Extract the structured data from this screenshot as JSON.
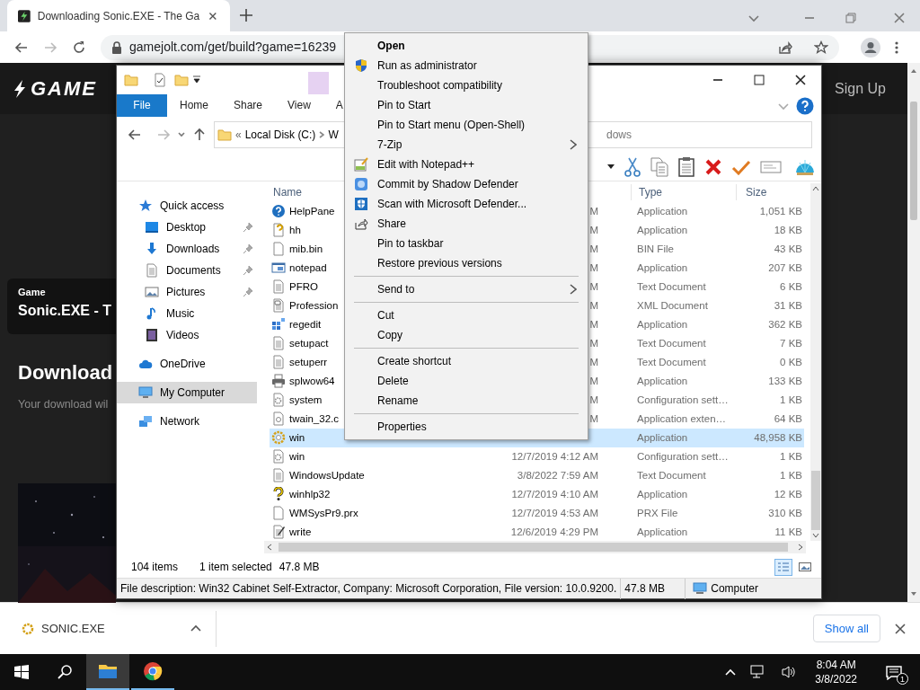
{
  "browser": {
    "tab_title": "Downloading Sonic.EXE - The Ga",
    "url": "gamejolt.com/get/build?game=16239"
  },
  "site": {
    "logo": "GAME",
    "sign_up": "Sign Up",
    "card_label": "Game",
    "card_title": "Sonic.EXE - T",
    "heading": "Download",
    "subtext": "Your download wil"
  },
  "explorer": {
    "ribbon_tabs": [
      {
        "kind": "file",
        "label": "File"
      },
      {
        "kind": "tab",
        "label": "Home"
      },
      {
        "kind": "tab",
        "label": "Share"
      },
      {
        "kind": "tab",
        "label": "View"
      },
      {
        "kind": "contextual",
        "label": "A"
      }
    ],
    "address": {
      "overflow": "«",
      "crumbs": [
        "Local Disk (C:)",
        "W"
      ]
    },
    "search": {
      "placeholder": "dows"
    },
    "columns": [
      {
        "kind": "name",
        "label": "Name"
      },
      {
        "kind": "type",
        "label": "Type"
      },
      {
        "kind": "size",
        "label": "Size"
      }
    ],
    "nav": [
      {
        "kind": "star",
        "label": "Quick access",
        "selected": false,
        "children": [
          {
            "kind": "desktop",
            "label": "Desktop",
            "pinned": true,
            "selected": false
          },
          {
            "kind": "downloads",
            "label": "Downloads",
            "pinned": true,
            "selected": false
          },
          {
            "kind": "documents",
            "label": "Documents",
            "pinned": true,
            "selected": false
          },
          {
            "kind": "pictures",
            "label": "Pictures",
            "pinned": true,
            "selected": false
          },
          {
            "kind": "music",
            "label": "Music",
            "pinned": false,
            "selected": false
          },
          {
            "kind": "videos",
            "label": "Videos",
            "pinned": false,
            "selected": false
          }
        ]
      },
      {
        "kind": "cloud",
        "label": "OneDrive",
        "selected": false
      },
      {
        "kind": "computer",
        "label": "My Computer",
        "selected": true
      },
      {
        "kind": "network",
        "label": "Network",
        "selected": false
      }
    ],
    "rows": [
      {
        "kind": "help",
        "name": "HelpPane",
        "date": "M",
        "type": "Application",
        "size": "1,051 KB",
        "selected": false
      },
      {
        "kind": "hh",
        "name": "hh",
        "date": "M",
        "type": "Application",
        "size": "18 KB",
        "selected": false
      },
      {
        "kind": "blank",
        "name": "mib.bin",
        "date": "M",
        "type": "BIN File",
        "size": "43 KB",
        "selected": false
      },
      {
        "kind": "notepad",
        "name": "notepad",
        "date": "M",
        "type": "Application",
        "size": "207 KB",
        "selected": false
      },
      {
        "kind": "text",
        "name": "PFRO",
        "date": "M",
        "type": "Text Document",
        "size": "6 KB",
        "selected": false
      },
      {
        "kind": "xml",
        "name": "Profession",
        "date": "M",
        "type": "XML Document",
        "size": "31 KB",
        "selected": false
      },
      {
        "kind": "regedit",
        "name": "regedit",
        "date": "M",
        "type": "Application",
        "size": "362 KB",
        "selected": false
      },
      {
        "kind": "text",
        "name": "setupact",
        "date": "M",
        "type": "Text Document",
        "size": "7 KB",
        "selected": false
      },
      {
        "kind": "text",
        "name": "setuperr",
        "date": "M",
        "type": "Text Document",
        "size": "0 KB",
        "selected": false
      },
      {
        "kind": "printer",
        "name": "splwow64",
        "date": "M",
        "type": "Application",
        "size": "133 KB",
        "selected": false
      },
      {
        "kind": "settings",
        "name": "system",
        "date": "M",
        "type": "Configuration sett…",
        "size": "1 KB",
        "selected": false
      },
      {
        "kind": "dll",
        "name": "twain_32.c",
        "date": "M",
        "type": "Application exten…",
        "size": "64 KB",
        "selected": false
      },
      {
        "kind": "setup",
        "name": "win",
        "type": "Application",
        "size": "48,958 KB",
        "selected": true
      },
      {
        "kind": "settings",
        "name": "win",
        "date": "12/7/2019 4:12 AM",
        "type": "Configuration sett…",
        "size": "1 KB",
        "selected": false
      },
      {
        "kind": "text",
        "name": "WindowsUpdate",
        "date": "3/8/2022 7:59 AM",
        "type": "Text Document",
        "size": "1 KB",
        "selected": false
      },
      {
        "kind": "winhelp",
        "name": "winhlp32",
        "date": "12/7/2019 4:10 AM",
        "type": "Application",
        "size": "12 KB",
        "selected": false
      },
      {
        "kind": "blank",
        "name": "WMSysPr9.prx",
        "date": "12/7/2019 4:53 AM",
        "type": "PRX File",
        "size": "310 KB",
        "selected": false
      },
      {
        "kind": "write",
        "name": "write",
        "date": "12/6/2019 4:29 PM",
        "type": "Application",
        "size": "11 KB",
        "selected": false
      }
    ],
    "status": {
      "count": "104 items",
      "selection": "1 item selected",
      "size": "47.8 MB"
    },
    "views": [
      {
        "kind": "details",
        "selected": true
      },
      {
        "kind": "preview",
        "selected": false
      }
    ],
    "details_bar": {
      "description": "File description: Win32 Cabinet Self-Extractor, Company: Microsoft Corporation, File version: 10.0.9200.",
      "size": "47.8 MB",
      "location": "Computer"
    }
  },
  "context_menu": {
    "groups": [
      [
        {
          "label": "Open",
          "default": true,
          "submenu": false
        },
        {
          "label": "Run as administrator",
          "kind": "shield",
          "default": false,
          "submenu": false
        },
        {
          "label": "Troubleshoot compatibility",
          "default": false,
          "submenu": false
        },
        {
          "label": "Pin to Start",
          "default": false,
          "submenu": false
        },
        {
          "label": "Pin to Start menu (Open-Shell)",
          "default": false,
          "submenu": false
        },
        {
          "label": "7-Zip",
          "default": false,
          "submenu": true
        },
        {
          "label": "Edit with Notepad++",
          "kind": "notepad",
          "default": false,
          "submenu": false
        },
        {
          "label": "Commit by Shadow Defender",
          "kind": "shadow",
          "default": false,
          "submenu": false
        },
        {
          "label": "Scan with Microsoft Defender...",
          "kind": "defender",
          "default": false,
          "submenu": false
        },
        {
          "label": "Share",
          "kind": "share",
          "default": false,
          "submenu": false
        },
        {
          "label": "Pin to taskbar",
          "default": false,
          "submenu": false
        },
        {
          "label": "Restore previous versions",
          "default": false,
          "submenu": false
        }
      ],
      [
        {
          "label": "Send to",
          "default": false,
          "submenu": true
        }
      ],
      [
        {
          "label": "Cut",
          "default": false,
          "submenu": false
        },
        {
          "label": "Copy",
          "default": false,
          "submenu": false
        }
      ],
      [
        {
          "label": "Create shortcut",
          "default": false,
          "submenu": false
        },
        {
          "label": "Delete",
          "default": false,
          "submenu": false
        },
        {
          "label": "Rename",
          "default": false,
          "submenu": false
        }
      ],
      [
        {
          "label": "Properties",
          "default": false,
          "submenu": false
        }
      ]
    ]
  },
  "download_bar": {
    "file": "SONIC.EXE",
    "show_all": "Show all"
  },
  "taskbar": {
    "apps": [
      {
        "kind": "explorer",
        "active": true
      },
      {
        "kind": "browser",
        "active": false
      }
    ],
    "time": "8:04 AM",
    "date": "3/8/2022",
    "notification_count": "1"
  }
}
